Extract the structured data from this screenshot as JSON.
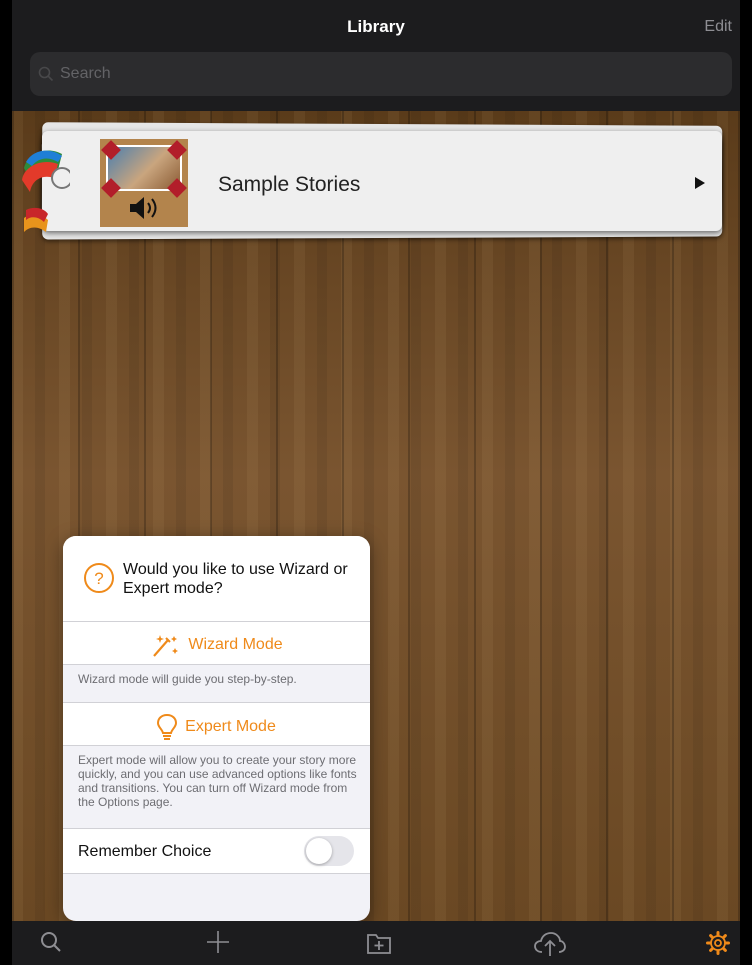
{
  "header": {
    "title": "Library",
    "edit_label": "Edit"
  },
  "search": {
    "placeholder": "Search",
    "icon": "search-icon"
  },
  "library": {
    "items": [
      {
        "label": "Sample Stories",
        "thumbnail": "story-thumbnail",
        "badge_icon": "speaker-icon",
        "chevron": "chevron-right-icon"
      }
    ]
  },
  "popover": {
    "question": "Would you like to use Wizard or Expert mode?",
    "question_icon": "question-circle-icon",
    "wizard": {
      "label": "Wizard Mode",
      "icon": "magic-wand-icon",
      "note": "Wizard mode will guide you step-by-step."
    },
    "expert": {
      "label": "Expert Mode",
      "icon": "lightbulb-icon",
      "note": "Expert mode will allow you to create your story more quickly, and you can use advanced options like fonts and transitions.  You can turn off Wizard mode from the Options page."
    },
    "remember": {
      "label": "Remember Choice",
      "on": false
    }
  },
  "toolbar": {
    "icons": [
      "search-icon",
      "plus-icon",
      "add-folder-icon",
      "cloud-upload-icon",
      "gear-icon"
    ]
  },
  "colors": {
    "accent": "#ef8a1a",
    "bar": "#1c1c1e",
    "popover": "#f2f2f7"
  }
}
